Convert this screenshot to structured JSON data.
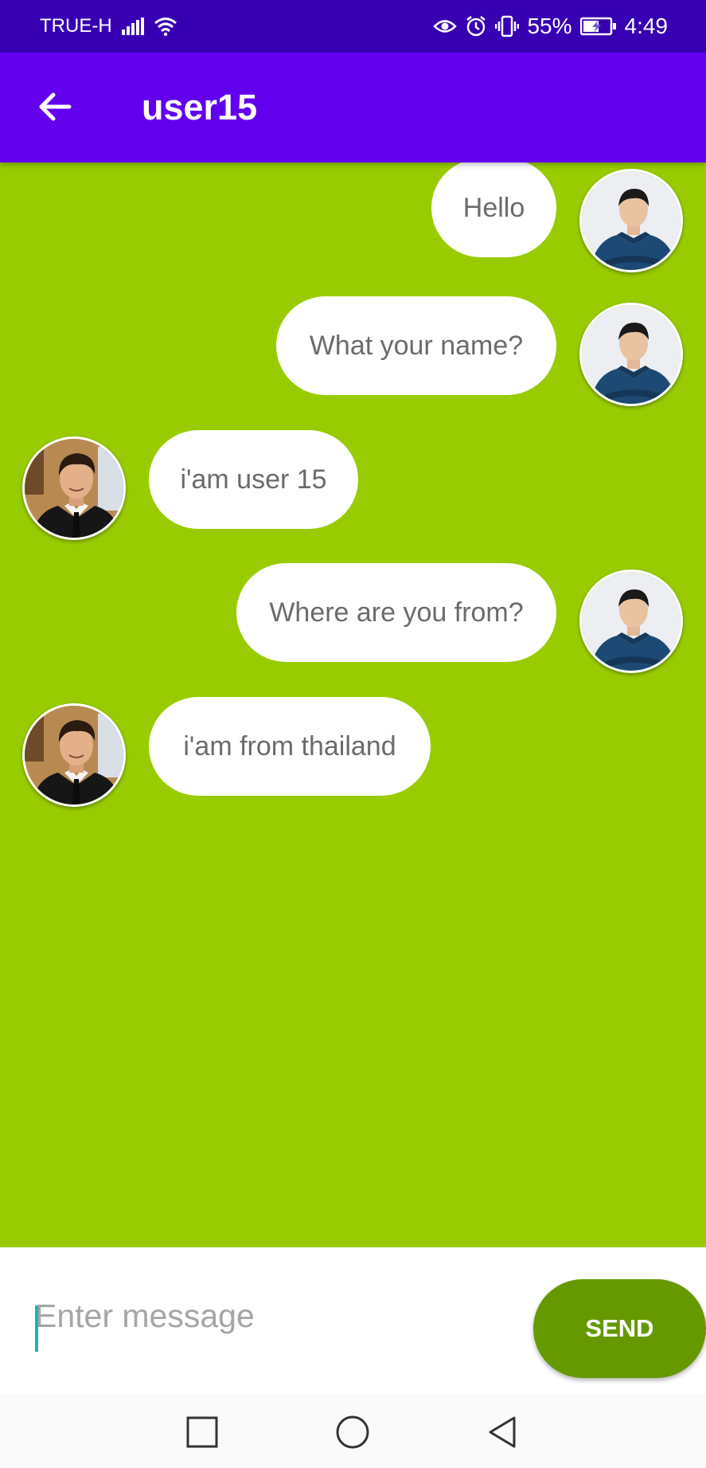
{
  "status_bar": {
    "carrier": "TRUE-H",
    "battery_percent": "55%",
    "time": "4:49",
    "icons": [
      "signal-icon",
      "wifi-icon",
      "eye-icon",
      "alarm-icon",
      "vibrate-icon",
      "battery-charging-icon"
    ]
  },
  "app_bar": {
    "title": "user15",
    "back_icon": "arrow-left-icon"
  },
  "messages": [
    {
      "sender": "me",
      "text": "Hello"
    },
    {
      "sender": "me",
      "text": "What your name?"
    },
    {
      "sender": "other",
      "text": "i'am user 15"
    },
    {
      "sender": "me",
      "text": "Where are you from?"
    },
    {
      "sender": "other",
      "text": "i'am from thailand"
    }
  ],
  "composer": {
    "placeholder": "Enter message",
    "value": "",
    "send_label": "SEND"
  },
  "nav_bar": {
    "icons": [
      "square-recents-icon",
      "circle-home-icon",
      "triangle-back-icon"
    ]
  },
  "colors": {
    "status_bar": "#3700B3",
    "app_bar": "#6200EE",
    "chat_bg": "#98CC00",
    "send_button": "#669900"
  }
}
